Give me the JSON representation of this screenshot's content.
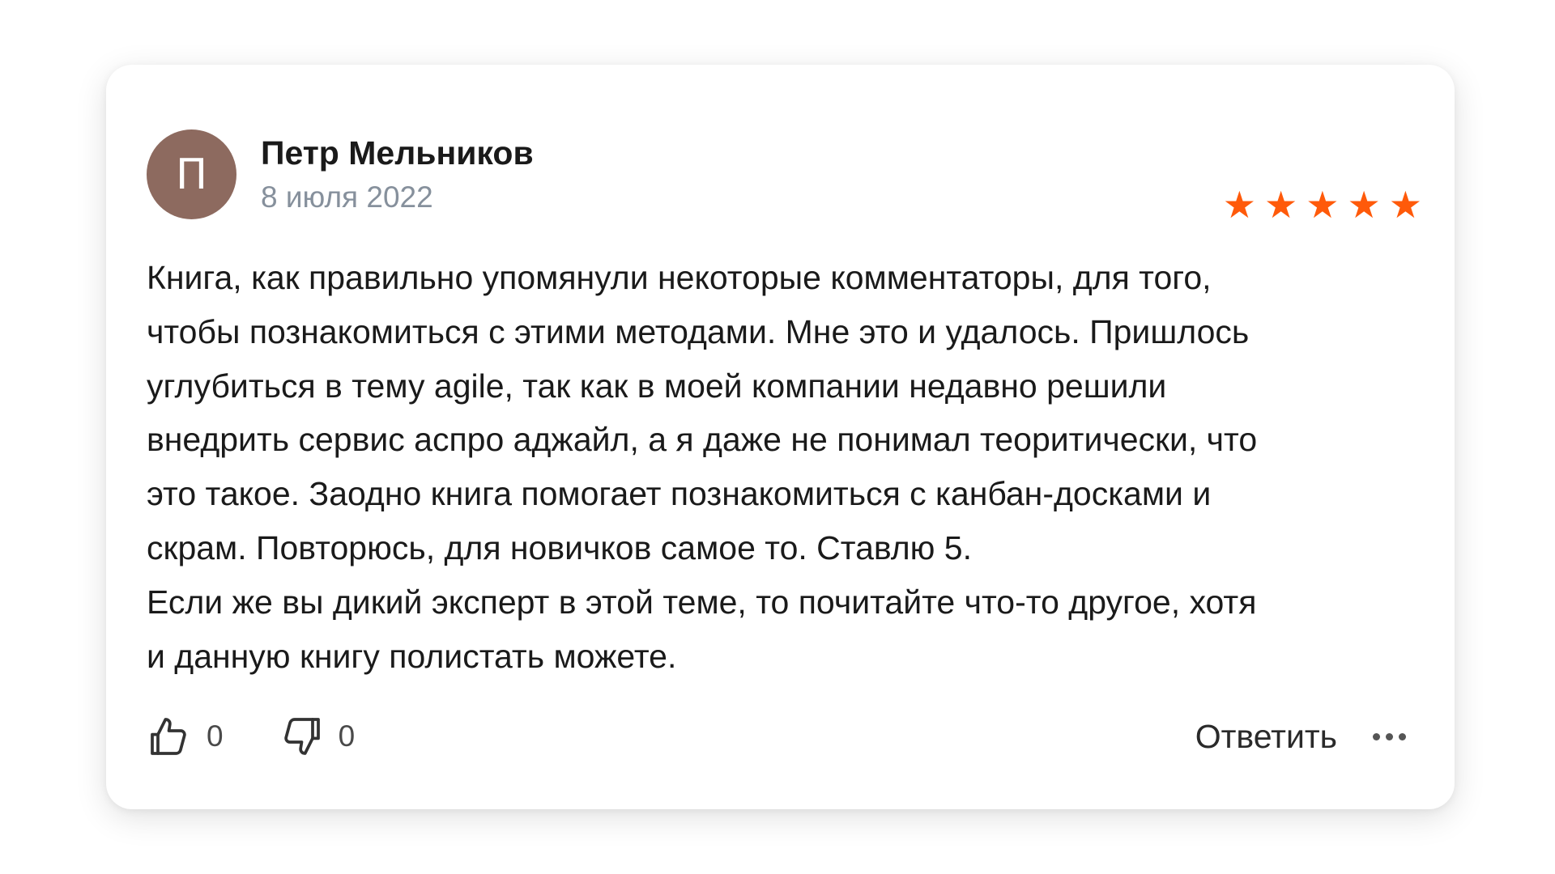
{
  "review": {
    "author": {
      "initial": "П",
      "name": "Петр Мельников",
      "avatar_color": "#8d6a5f"
    },
    "date": "8 июля 2022",
    "rating": {
      "value": 5,
      "max": 5,
      "star_color": "#ff5a0a"
    },
    "text": "Книга, как правильно упомянули некоторые комментаторы, для того,\nчтобы познакомиться с этими методами. Мне это и удалось. Пришлось\nуглубиться в тему agile, так как в моей компании недавно решили\nвнедрить сервис аспро аджайл, а я даже не понимал теоритически, что\nэто такое. Заодно книга помогает познакомиться с канбан-досками и\nскрам. Повторюсь, для новичков самое то. Ставлю 5.\nЕсли же вы дикий эксперт в этой теме, то почитайте что-то другое, хотя\nи данную книгу полистать можете."
  },
  "actions": {
    "likes": {
      "count": "0",
      "icon": "thumbs-up-icon"
    },
    "dislikes": {
      "count": "0",
      "icon": "thumbs-down-icon"
    },
    "reply_label": "Ответить",
    "more_icon": "more-dots-icon"
  }
}
